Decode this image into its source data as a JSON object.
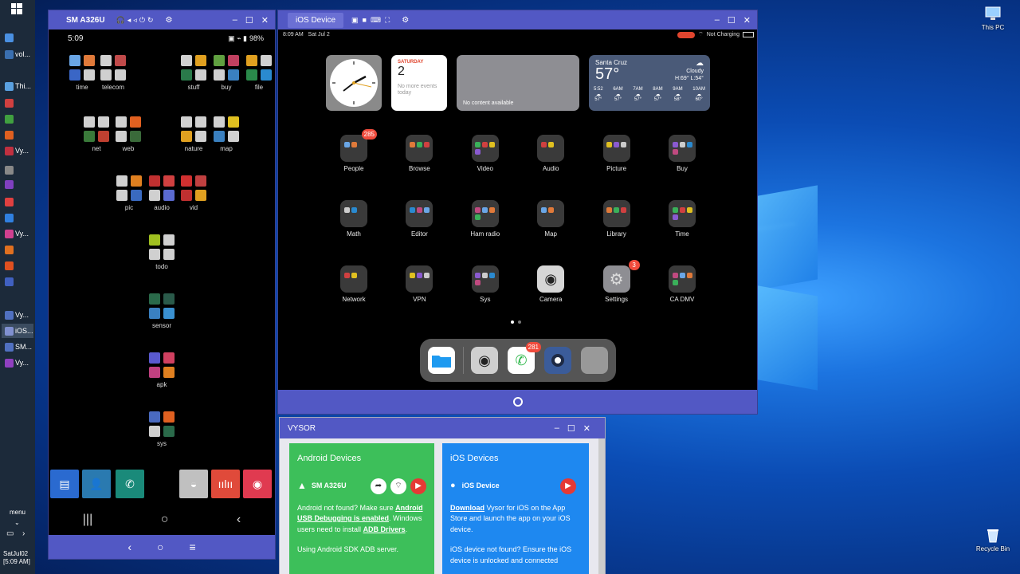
{
  "taskbar": {
    "items": [
      {
        "label": "",
        "color": "#4a90e2"
      },
      {
        "label": "vol...",
        "color": "#3a6fb0"
      },
      {
        "label": "Thi...",
        "color": "#5aa0e0"
      },
      {
        "label": "",
        "color": "#d04040"
      },
      {
        "label": "",
        "color": "#40a040"
      },
      {
        "label": "",
        "color": "#e06020"
      },
      {
        "label": "Vy...",
        "color": "#c03040"
      },
      {
        "label": "",
        "color": "#888888"
      },
      {
        "label": "",
        "color": "#8040c0"
      },
      {
        "label": "",
        "color": "#e04040"
      },
      {
        "label": "",
        "color": "#3080e0"
      },
      {
        "label": "Vy...",
        "color": "#d04090"
      },
      {
        "label": "",
        "color": "#e07020"
      },
      {
        "label": "",
        "color": "#e05020"
      },
      {
        "label": "",
        "color": "#4060c0"
      },
      {
        "label": "Vy...",
        "color": "#5070c0"
      },
      {
        "label": "iOS...",
        "color": "#8090d0"
      },
      {
        "label": "SM...",
        "color": "#5070c0"
      },
      {
        "label": "Vy...",
        "color": "#9040c0"
      }
    ],
    "menu_label": "menu",
    "clock_date": "SatJul02",
    "clock_time": "[5:09 AM]"
  },
  "desktop": {
    "this_pc": "This PC",
    "recycle_bin": "Recycle Bin"
  },
  "android_window": {
    "title": "SM A326U",
    "status_time": "5:09",
    "status_battery": "98%",
    "folders": [
      {
        "label": "time",
        "colors": [
          "#6aa6e6",
          "#e07a3a",
          "#3a66c6",
          "#d0d0d0"
        ]
      },
      {
        "label": "telecom",
        "colors": [
          "#d0d0d0",
          "#c04a4a",
          "#d0d0d0",
          "#d0d0d0"
        ]
      },
      {
        "label": "stuff",
        "colors": [
          "#d0d0d0",
          "#e0a020",
          "#2a7a4a",
          "#d0d0d0"
        ]
      },
      {
        "label": "buy",
        "colors": [
          "#60a040",
          "#c04060",
          "#d0d0d0",
          "#3a80c0"
        ]
      },
      {
        "label": "file",
        "colors": [
          "#e0a020",
          "#d0d0d0",
          "#2a8a4a",
          "#2a8ad0"
        ]
      },
      {
        "label": "net",
        "colors": [
          "#d0d0d0",
          "#d0d0d0",
          "#3a7a3a",
          "#c04030"
        ]
      },
      {
        "label": "web",
        "colors": [
          "#d0d0d0",
          "#e06020",
          "#d0d0d0",
          "#3a6a3a"
        ]
      },
      {
        "label": "nature",
        "colors": [
          "#d0d0d0",
          "#d0d0d0",
          "#e0a020",
          "#d0d0d0"
        ]
      },
      {
        "label": "map",
        "colors": [
          "#d0d0d0",
          "#e0c020",
          "#3a80c0",
          "#d0d0d0"
        ]
      },
      {
        "label": "pic",
        "colors": [
          "#d0d0d0",
          "#e08020",
          "#d0d0d0",
          "#3a6ac0"
        ]
      },
      {
        "label": "audio",
        "colors": [
          "#c03030",
          "#d04040",
          "#d0d0d0",
          "#5a6ad0"
        ]
      },
      {
        "label": "vid",
        "colors": [
          "#d03030",
          "#c04040",
          "#c03030",
          "#e0a020"
        ]
      },
      {
        "label": "todo",
        "colors": [
          "#a0c020",
          "#d0d0d0",
          "#d0d0d0",
          "#d0d0d0"
        ]
      },
      {
        "label": "sensor",
        "colors": [
          "#2a6a4a",
          "#2a5a4a",
          "#3a80c0",
          "#3a90d0"
        ]
      },
      {
        "label": "apk",
        "colors": [
          "#5a5ad0",
          "#d04060",
          "#c04080",
          "#e08020"
        ]
      },
      {
        "label": "sys",
        "colors": [
          "#4a6ac0",
          "#e06020",
          "#d0d0d0",
          "#2a6a4a"
        ]
      }
    ],
    "dock": [
      {
        "name": "messages",
        "color": "#2a6ad0"
      },
      {
        "name": "contacts",
        "color": "#2a7ab0"
      },
      {
        "name": "phone",
        "color": "#1a8a7a"
      },
      {
        "name": "android-apps",
        "color": "#c0c0c0"
      },
      {
        "name": "recorder",
        "color": "#e04a3a"
      },
      {
        "name": "camera",
        "color": "#e03a50"
      }
    ],
    "nav": {
      "recents": "|||",
      "home": "○",
      "back": "‹"
    },
    "bottom": {
      "back": "‹",
      "home": "○",
      "menu": "≡"
    }
  },
  "ios_window": {
    "title": "iOS Device",
    "status_time": "8:09 AM",
    "status_date": "Sat Jul 2",
    "status_charging": "Not Charging",
    "calendar": {
      "day": "SATURDAY",
      "date": "2",
      "text": "No more events today"
    },
    "photos_widget": "No content available",
    "weather": {
      "city": "Santa Cruz",
      "temp": "57°",
      "condition": "Cloudy",
      "hilo": "H:69° L:54°",
      "hours": [
        "5:52",
        "6AM",
        "7AM",
        "8AM",
        "9AM",
        "10AM"
      ],
      "temps": [
        "57°",
        "57°",
        "57°",
        "57°",
        "58°",
        "60°"
      ]
    },
    "apps": [
      {
        "label": "People",
        "badge": "285"
      },
      {
        "label": "Browse",
        "badge": ""
      },
      {
        "label": "Video",
        "badge": ""
      },
      {
        "label": "Audio",
        "badge": ""
      },
      {
        "label": "Picture",
        "badge": ""
      },
      {
        "label": "Buy",
        "badge": ""
      },
      {
        "label": "Math",
        "badge": ""
      },
      {
        "label": "Editor",
        "badge": ""
      },
      {
        "label": "Ham radio",
        "badge": ""
      },
      {
        "label": "Map",
        "badge": ""
      },
      {
        "label": "Library",
        "badge": ""
      },
      {
        "label": "Time",
        "badge": ""
      },
      {
        "label": "Network",
        "badge": ""
      },
      {
        "label": "VPN",
        "badge": ""
      },
      {
        "label": "Sys",
        "badge": ""
      },
      {
        "label": "Camera",
        "badge": ""
      },
      {
        "label": "Settings",
        "badge": "3"
      },
      {
        "label": "CA DMV",
        "badge": ""
      }
    ],
    "dock_badge": "281"
  },
  "vysor": {
    "title": "VYSOR",
    "android": {
      "heading": "Android Devices",
      "device": "SM A326U",
      "p1_a": "Android not found? Make sure",
      "p1_link": "Android USB Debugging is enabled",
      "p1_b": ". Windows users need to install",
      "p1_link2": "ADB Drivers",
      "p2": "Using Android SDK ADB server."
    },
    "ios": {
      "heading": "iOS Devices",
      "device": "iOS Device",
      "p1_link": "Download",
      "p1": "Vysor for iOS on the App Store and launch the app on your iOS device.",
      "p2": "iOS device not found? Ensure the iOS device is unlocked and connected"
    }
  },
  "colors": {
    "window_accent": "#5258c4",
    "android_card": "#3dbf5a",
    "ios_card": "#1e88f0"
  }
}
